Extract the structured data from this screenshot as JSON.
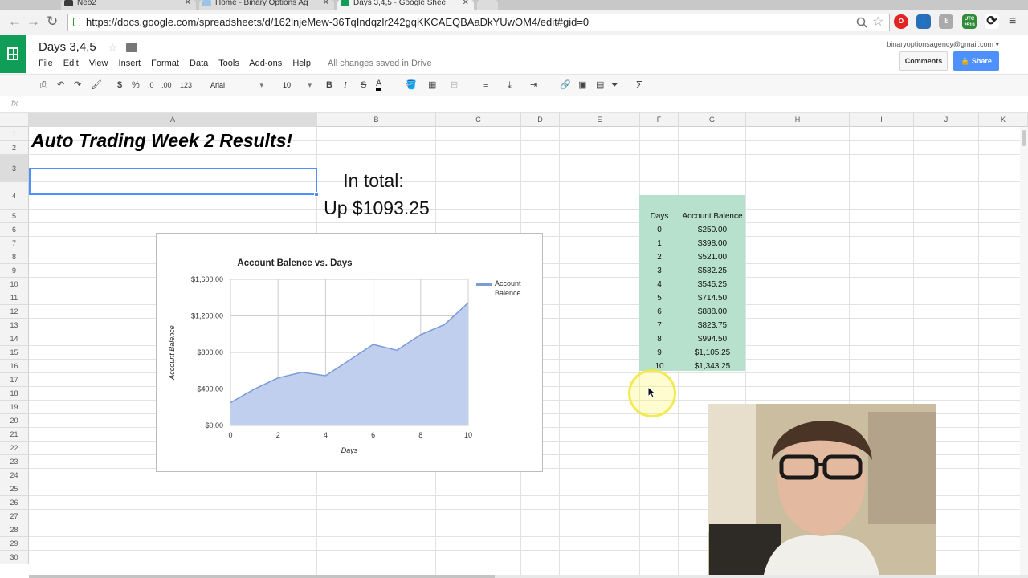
{
  "browser": {
    "tabs": [
      {
        "label": "Neo2",
        "icon": "wordpress-icon"
      },
      {
        "label": "Home - Binary Options Ag",
        "icon": "shield-icon"
      },
      {
        "label": "Days 3,4,5 - Google Shee",
        "icon": "sheets-icon"
      }
    ],
    "url": "https://docs.google.com/spreadsheets/d/162lnjeMew-36TqIndqzlr242gqKKCAEQBAaDkYUwOM4/edit#gid=0",
    "ext_badge": "UTC 2519"
  },
  "sheets": {
    "doc_title": "Days 3,4,5",
    "menu": [
      "File",
      "Edit",
      "View",
      "Insert",
      "Format",
      "Data",
      "Tools",
      "Add-ons",
      "Help"
    ],
    "save_status": "All changes saved in Drive",
    "account_email": "binaryoptionsagency@gmail.com",
    "comments_label": "Comments",
    "share_label": "Share",
    "toolbar": {
      "currency": "$",
      "percent": "%",
      "decrease_decimals": ".0",
      "increase_decimals": ".00",
      "more_formats": "123",
      "font": "Arial",
      "font_size": "10",
      "bold": "B",
      "italic": "I",
      "strike": "S",
      "text_color": "A",
      "functions": "Σ"
    },
    "formula_label": "fx",
    "accent_color": "#0f9d58",
    "share_color": "#4d90fe"
  },
  "grid": {
    "columns": [
      "A",
      "B",
      "C",
      "D",
      "E",
      "F",
      "G",
      "H",
      "I",
      "J",
      "K"
    ],
    "rows": [
      "1",
      "2",
      "3",
      "4",
      "5",
      "6",
      "7",
      "8",
      "9",
      "10",
      "11",
      "12",
      "13",
      "14",
      "15",
      "16",
      "17",
      "18",
      "19",
      "20",
      "21",
      "22",
      "23",
      "24",
      "25",
      "26",
      "27",
      "28",
      "29",
      "30"
    ],
    "selected_cell": "A3"
  },
  "cells": {
    "title": "Auto Trading Week 2 Results!",
    "total_line1": "In total:",
    "total_line2": "Up $1093.25",
    "table_header_days": "Days",
    "table_header_balance": "Account Balence",
    "table_rows": [
      {
        "day": "0",
        "balance": "$250.00"
      },
      {
        "day": "1",
        "balance": "$398.00"
      },
      {
        "day": "2",
        "balance": "$521.00"
      },
      {
        "day": "3",
        "balance": "$582.25"
      },
      {
        "day": "4",
        "balance": "$545.25"
      },
      {
        "day": "5",
        "balance": "$714.50"
      },
      {
        "day": "6",
        "balance": "$888.00"
      },
      {
        "day": "7",
        "balance": "$823.75"
      },
      {
        "day": "8",
        "balance": "$994.50"
      },
      {
        "day": "9",
        "balance": "$1,105.25"
      },
      {
        "day": "10",
        "balance": "$1,343.25"
      }
    ],
    "table_color": "#b7e1cd"
  },
  "chart_data": {
    "type": "area",
    "title": "Account Balence vs. Days",
    "xlabel": "Days",
    "ylabel": "Account Balence",
    "x": [
      0,
      1,
      2,
      3,
      4,
      5,
      6,
      7,
      8,
      9,
      10
    ],
    "series": [
      {
        "name": "Account Balence",
        "values": [
          250.0,
          398.0,
          521.0,
          582.25,
          545.25,
          714.5,
          888.0,
          823.75,
          994.5,
          1105.25,
          1343.25
        ]
      }
    ],
    "xticks": [
      "0",
      "2",
      "4",
      "6",
      "8",
      "10"
    ],
    "yticks": [
      "$0.00",
      "$400.00",
      "$800.00",
      "$1,200.00",
      "$1,600.00"
    ],
    "xlim": [
      0,
      10
    ],
    "ylim": [
      0,
      1600
    ],
    "legend": "right",
    "grid": true,
    "line_color": "#7b9ad8",
    "fill_color": "#c1cfef"
  }
}
